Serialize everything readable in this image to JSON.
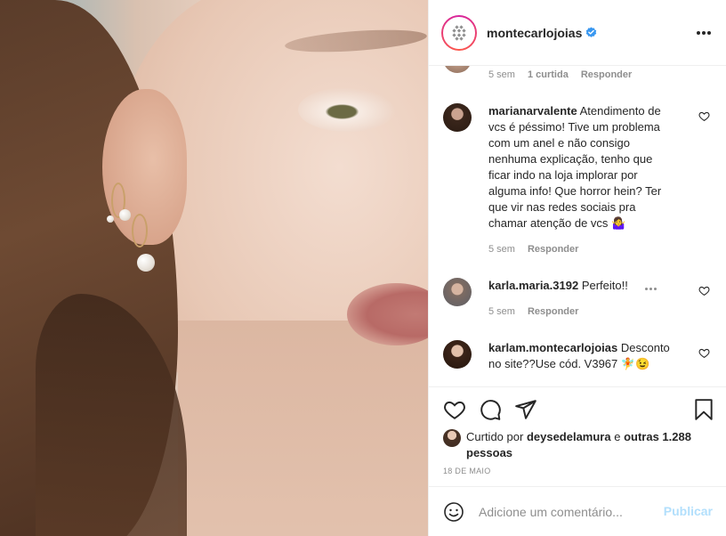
{
  "post": {
    "username": "montecarlojoias",
    "verified": true,
    "more_icon": "more-horizontal-icon"
  },
  "top_comment_meta": {
    "time": "5 sem",
    "likes": "1 curtida",
    "reply": "Responder"
  },
  "comments": [
    {
      "user": "marianarvalente",
      "text": "Atendimento de vcs é péssimo! Tive um problema com um anel e não consigo nenhuma explicação, tenho que ficar indo na loja implorar por alguma info! Que horror hein? Ter que vir nas redes sociais pra chamar atenção de vcs 🤷‍♀️",
      "time": "5 sem",
      "reply": "Responder"
    },
    {
      "user": "karla.maria.3192",
      "text": "Perfeito!!",
      "time": "5 sem",
      "reply": "Responder"
    },
    {
      "user": "karlam.montecarlojoias",
      "text": "Desconto no site??Use cód. V3967 🧚😉"
    }
  ],
  "likes": {
    "prefix": "Curtido por",
    "user": "deysedelamura",
    "conjunction": "e",
    "others": "outras 1.288 pessoas"
  },
  "date": "18 DE MAIO",
  "add_comment": {
    "placeholder": "Adicione um comentário...",
    "publish_label": "Publicar"
  },
  "colors": {
    "verified_blue": "#3897f0",
    "publish_disabled": "#b2dffc",
    "meta_gray": "#8e8e8e"
  }
}
